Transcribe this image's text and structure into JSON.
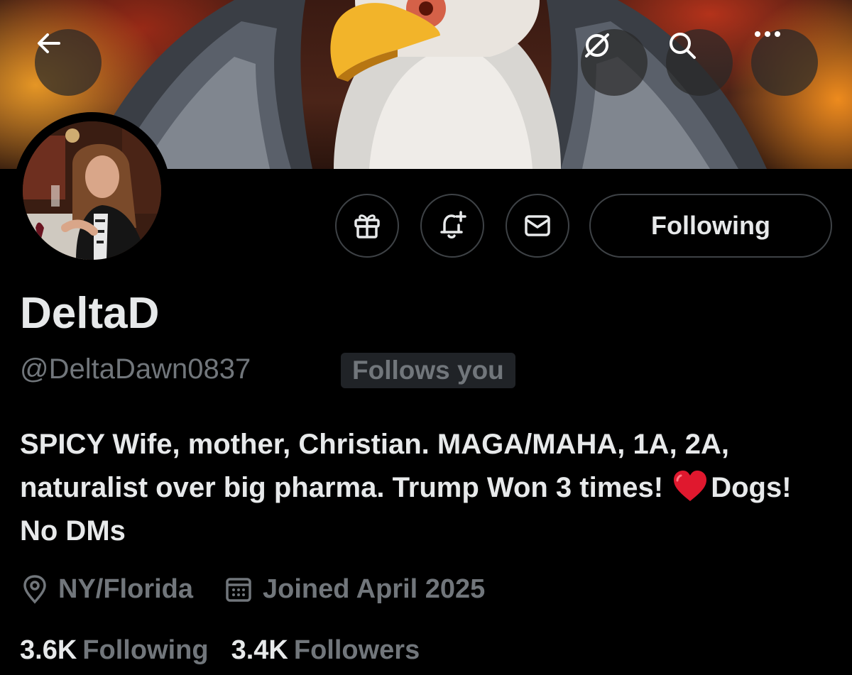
{
  "header": {
    "back_icon": "arrow-left-icon",
    "grok_icon": "grok-icon",
    "search_icon": "search-icon",
    "more_icon": "more-horizontal-icon"
  },
  "banner": {
    "image": "bald-eagle-with-spread-wings-on-fiery-background"
  },
  "avatar": {
    "image": "woman-with-wine-glass-at-dinner"
  },
  "actions": {
    "gift_icon": "gift-icon",
    "notify_icon": "bell-plus-icon",
    "message_icon": "envelope-icon",
    "following_label": "Following"
  },
  "profile": {
    "display_name": "DeltaD",
    "handle": "@DeltaDawn0837",
    "follows_you": "Follows you",
    "bio_part1": "SPICY Wife, mother, Christian. MAGA/MAHA, 1A, 2A, naturalist over big pharma. Trump Won 3 times! ",
    "bio_emoji": "❤️",
    "bio_part2": "Dogs! No DMs",
    "location": "NY/Florida",
    "joined": "Joined April 2025"
  },
  "stats": {
    "following_count": "3.6K",
    "following_label": "Following",
    "followers_count": "3.4K",
    "followers_label": "Followers"
  },
  "colors": {
    "background": "#000000",
    "primary_text": "#e7e9ea",
    "secondary_text": "#71767b",
    "border": "#3e4246",
    "badge_bg": "#202327"
  }
}
